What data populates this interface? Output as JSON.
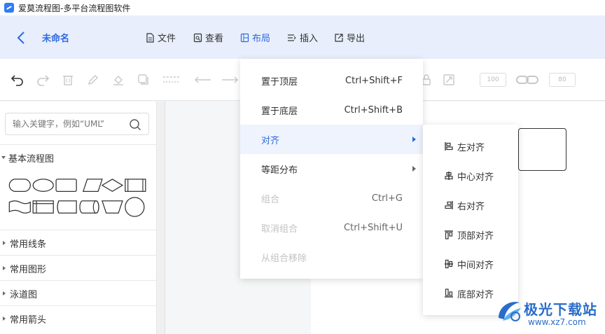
{
  "window": {
    "title": "爱莫流程图-多平台流程图软件"
  },
  "menubar": {
    "doc_name": "未命名",
    "items": [
      {
        "label": "文件"
      },
      {
        "label": "查看"
      },
      {
        "label": "布局"
      },
      {
        "label": "插入"
      },
      {
        "label": "导出"
      }
    ]
  },
  "toolbar": {
    "tools": [
      "undo-icon",
      "redo-icon",
      "delete-icon",
      "pencil-icon",
      "fill-icon",
      "shadow-icon",
      "line-style-icon",
      "arrow-left-icon",
      "arrow-right-icon",
      "resize-icon",
      "link-icon"
    ],
    "width_value": "100",
    "height_value": "80"
  },
  "sidebar": {
    "search": {
      "placeholder": "输入关键字，例如“UML”"
    },
    "sections": [
      {
        "label": "基本流程图",
        "expanded": true
      },
      {
        "label": "常用线条",
        "expanded": false
      },
      {
        "label": "常用图形",
        "expanded": false
      },
      {
        "label": "泳道图",
        "expanded": false
      },
      {
        "label": "常用箭头",
        "expanded": false
      }
    ]
  },
  "context_menu": {
    "items": [
      {
        "label": "置于顶层",
        "shortcut": "Ctrl+Shift+F",
        "state": "normal"
      },
      {
        "label": "置于底层",
        "shortcut": "Ctrl+Shift+B",
        "state": "normal"
      },
      {
        "label": "对齐",
        "shortcut": "",
        "state": "highlight",
        "submenu": true
      },
      {
        "label": "等距分布",
        "shortcut": "",
        "state": "normal",
        "submenu": true
      },
      {
        "label": "组合",
        "shortcut": "Ctrl+G",
        "state": "disabled"
      },
      {
        "label": "取消组合",
        "shortcut": "Ctrl+Shift+U",
        "state": "disabled"
      },
      {
        "label": "从组合移除",
        "shortcut": "",
        "state": "disabled"
      }
    ]
  },
  "align_submenu": {
    "items": [
      {
        "label": "左对齐",
        "icon": "align-left-icon"
      },
      {
        "label": "中心对齐",
        "icon": "align-center-icon"
      },
      {
        "label": "右对齐",
        "icon": "align-right-icon"
      },
      {
        "label": "顶部对齐",
        "icon": "align-top-icon"
      },
      {
        "label": "中间对齐",
        "icon": "align-middle-icon"
      },
      {
        "label": "底部对齐",
        "icon": "align-bottom-icon"
      }
    ]
  },
  "watermark": {
    "title": "极光下载站",
    "url": "www.xz7.com"
  },
  "colors": {
    "accent": "#2d6ae0",
    "menubar_bg": "#e8eefb",
    "highlight_bg": "#eef3fd",
    "disabled": "#c2c2c2"
  }
}
